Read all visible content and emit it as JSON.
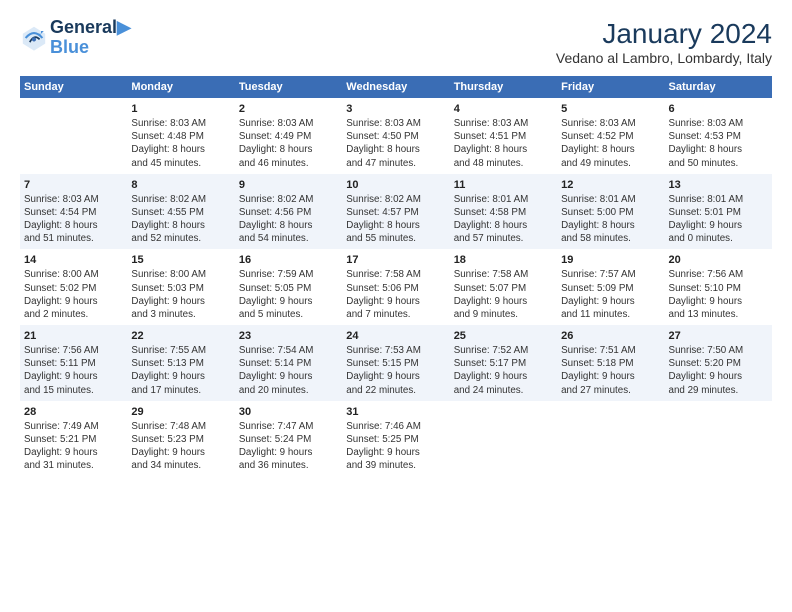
{
  "logo": {
    "line1": "General",
    "line2": "Blue"
  },
  "title": "January 2024",
  "subtitle": "Vedano al Lambro, Lombardy, Italy",
  "weekdays": [
    "Sunday",
    "Monday",
    "Tuesday",
    "Wednesday",
    "Thursday",
    "Friday",
    "Saturday"
  ],
  "weeks": [
    [
      {
        "num": "",
        "info": ""
      },
      {
        "num": "1",
        "info": "Sunrise: 8:03 AM\nSunset: 4:48 PM\nDaylight: 8 hours\nand 45 minutes."
      },
      {
        "num": "2",
        "info": "Sunrise: 8:03 AM\nSunset: 4:49 PM\nDaylight: 8 hours\nand 46 minutes."
      },
      {
        "num": "3",
        "info": "Sunrise: 8:03 AM\nSunset: 4:50 PM\nDaylight: 8 hours\nand 47 minutes."
      },
      {
        "num": "4",
        "info": "Sunrise: 8:03 AM\nSunset: 4:51 PM\nDaylight: 8 hours\nand 48 minutes."
      },
      {
        "num": "5",
        "info": "Sunrise: 8:03 AM\nSunset: 4:52 PM\nDaylight: 8 hours\nand 49 minutes."
      },
      {
        "num": "6",
        "info": "Sunrise: 8:03 AM\nSunset: 4:53 PM\nDaylight: 8 hours\nand 50 minutes."
      }
    ],
    [
      {
        "num": "7",
        "info": "Sunrise: 8:03 AM\nSunset: 4:54 PM\nDaylight: 8 hours\nand 51 minutes."
      },
      {
        "num": "8",
        "info": "Sunrise: 8:02 AM\nSunset: 4:55 PM\nDaylight: 8 hours\nand 52 minutes."
      },
      {
        "num": "9",
        "info": "Sunrise: 8:02 AM\nSunset: 4:56 PM\nDaylight: 8 hours\nand 54 minutes."
      },
      {
        "num": "10",
        "info": "Sunrise: 8:02 AM\nSunset: 4:57 PM\nDaylight: 8 hours\nand 55 minutes."
      },
      {
        "num": "11",
        "info": "Sunrise: 8:01 AM\nSunset: 4:58 PM\nDaylight: 8 hours\nand 57 minutes."
      },
      {
        "num": "12",
        "info": "Sunrise: 8:01 AM\nSunset: 5:00 PM\nDaylight: 8 hours\nand 58 minutes."
      },
      {
        "num": "13",
        "info": "Sunrise: 8:01 AM\nSunset: 5:01 PM\nDaylight: 9 hours\nand 0 minutes."
      }
    ],
    [
      {
        "num": "14",
        "info": "Sunrise: 8:00 AM\nSunset: 5:02 PM\nDaylight: 9 hours\nand 2 minutes."
      },
      {
        "num": "15",
        "info": "Sunrise: 8:00 AM\nSunset: 5:03 PM\nDaylight: 9 hours\nand 3 minutes."
      },
      {
        "num": "16",
        "info": "Sunrise: 7:59 AM\nSunset: 5:05 PM\nDaylight: 9 hours\nand 5 minutes."
      },
      {
        "num": "17",
        "info": "Sunrise: 7:58 AM\nSunset: 5:06 PM\nDaylight: 9 hours\nand 7 minutes."
      },
      {
        "num": "18",
        "info": "Sunrise: 7:58 AM\nSunset: 5:07 PM\nDaylight: 9 hours\nand 9 minutes."
      },
      {
        "num": "19",
        "info": "Sunrise: 7:57 AM\nSunset: 5:09 PM\nDaylight: 9 hours\nand 11 minutes."
      },
      {
        "num": "20",
        "info": "Sunrise: 7:56 AM\nSunset: 5:10 PM\nDaylight: 9 hours\nand 13 minutes."
      }
    ],
    [
      {
        "num": "21",
        "info": "Sunrise: 7:56 AM\nSunset: 5:11 PM\nDaylight: 9 hours\nand 15 minutes."
      },
      {
        "num": "22",
        "info": "Sunrise: 7:55 AM\nSunset: 5:13 PM\nDaylight: 9 hours\nand 17 minutes."
      },
      {
        "num": "23",
        "info": "Sunrise: 7:54 AM\nSunset: 5:14 PM\nDaylight: 9 hours\nand 20 minutes."
      },
      {
        "num": "24",
        "info": "Sunrise: 7:53 AM\nSunset: 5:15 PM\nDaylight: 9 hours\nand 22 minutes."
      },
      {
        "num": "25",
        "info": "Sunrise: 7:52 AM\nSunset: 5:17 PM\nDaylight: 9 hours\nand 24 minutes."
      },
      {
        "num": "26",
        "info": "Sunrise: 7:51 AM\nSunset: 5:18 PM\nDaylight: 9 hours\nand 27 minutes."
      },
      {
        "num": "27",
        "info": "Sunrise: 7:50 AM\nSunset: 5:20 PM\nDaylight: 9 hours\nand 29 minutes."
      }
    ],
    [
      {
        "num": "28",
        "info": "Sunrise: 7:49 AM\nSunset: 5:21 PM\nDaylight: 9 hours\nand 31 minutes."
      },
      {
        "num": "29",
        "info": "Sunrise: 7:48 AM\nSunset: 5:23 PM\nDaylight: 9 hours\nand 34 minutes."
      },
      {
        "num": "30",
        "info": "Sunrise: 7:47 AM\nSunset: 5:24 PM\nDaylight: 9 hours\nand 36 minutes."
      },
      {
        "num": "31",
        "info": "Sunrise: 7:46 AM\nSunset: 5:25 PM\nDaylight: 9 hours\nand 39 minutes."
      },
      {
        "num": "",
        "info": ""
      },
      {
        "num": "",
        "info": ""
      },
      {
        "num": "",
        "info": ""
      }
    ]
  ],
  "colors": {
    "header_bg": "#3a6db5",
    "row_even": "#f0f4fa",
    "row_odd": "#ffffff",
    "title": "#1a3a5c"
  }
}
